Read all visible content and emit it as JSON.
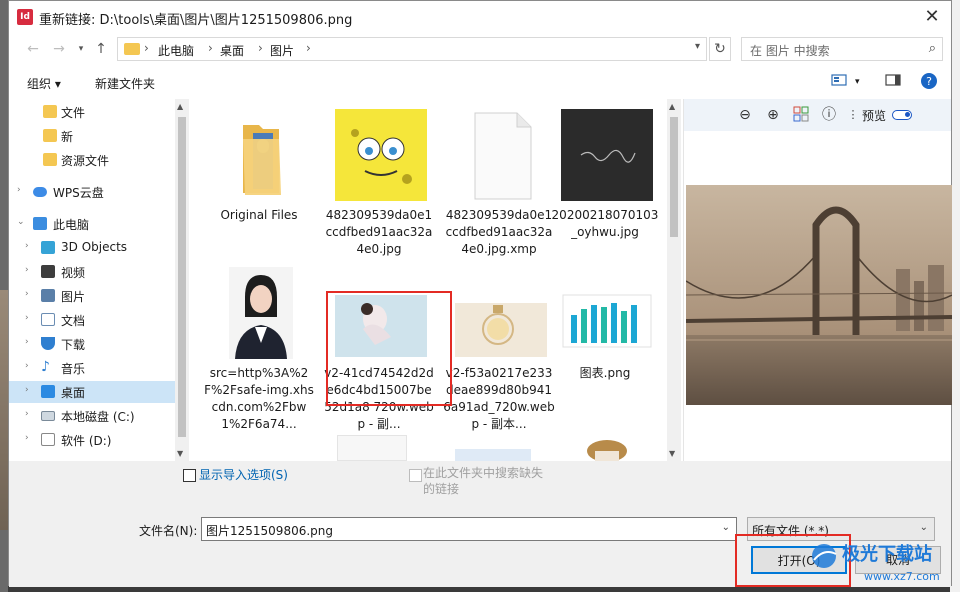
{
  "title": "重新链接: D:\\tools\\桌面\\图片\\图片1251509806.png",
  "app_icon_text": "Id",
  "address": {
    "crumbs": [
      "此电脑",
      "桌面",
      "图片"
    ]
  },
  "search": {
    "placeholder": "在 图片 中搜索"
  },
  "toolbar": {
    "organize": "组织 ▾",
    "new_folder": "新建文件夹"
  },
  "sidebar": {
    "items": [
      {
        "label": "文件",
        "icon": "folder-icon"
      },
      {
        "label": "新",
        "icon": "folder-icon"
      },
      {
        "label": "资源文件",
        "icon": "folder-icon"
      },
      {
        "label": "WPS云盘",
        "icon": "cloud-icon"
      },
      {
        "label": "此电脑",
        "icon": "computer-icon"
      },
      {
        "label": "3D Objects",
        "icon": "cube-icon"
      },
      {
        "label": "视频",
        "icon": "video-icon"
      },
      {
        "label": "图片",
        "icon": "pictures-icon"
      },
      {
        "label": "文档",
        "icon": "document-icon"
      },
      {
        "label": "下载",
        "icon": "download-icon"
      },
      {
        "label": "音乐",
        "icon": "music-icon"
      },
      {
        "label": "桌面",
        "icon": "desktop-icon",
        "selected": true
      },
      {
        "label": "本地磁盘 (C:)",
        "icon": "drive-icon"
      },
      {
        "label": "软件 (D:)",
        "icon": "drive-icon"
      }
    ]
  },
  "files": [
    {
      "name": "Original Files",
      "kind": "folder"
    },
    {
      "name": "482309539da0e1ccdfbed91aac32a4e0.jpg",
      "kind": "sponge"
    },
    {
      "name": "482309539da0e1ccdfbed91aac32a4e0.jpg.xmp",
      "kind": "blank"
    },
    {
      "name": "20200218070103_oyhwu.jpg",
      "kind": "dark"
    },
    {
      "name": "src=http%3A%2F%2Fsafe-img.xhscdn.com%2Fbw1%2F6a74...",
      "kind": "portrait"
    },
    {
      "name": "v2-41cd74542d2de6dc4bd15007be52d1a8 720w.webp - 副...",
      "kind": "woman"
    },
    {
      "name": "v2-f53a0217e233deae899d80b9416a91ad_720w.webp - 副本...",
      "kind": "perfume"
    },
    {
      "name": "图表.png",
      "kind": "chart"
    }
  ],
  "preview": {
    "label": "预览"
  },
  "bottom": {
    "show_import": "显示导入选项(S)",
    "search_folder": "在此文件夹中搜索缺失的链接",
    "filename_label": "文件名(N):",
    "filename_value": "图片1251509806.png",
    "filetype_value": "所有文件 (*.*)",
    "open": "打开(O)",
    "cancel": "取消"
  },
  "watermark": {
    "text": "极光下载站",
    "url": "www.xz7.com"
  },
  "colors": {
    "accent": "#0078d7",
    "selection": "#cce4f7",
    "highlight": "#e32b24"
  }
}
